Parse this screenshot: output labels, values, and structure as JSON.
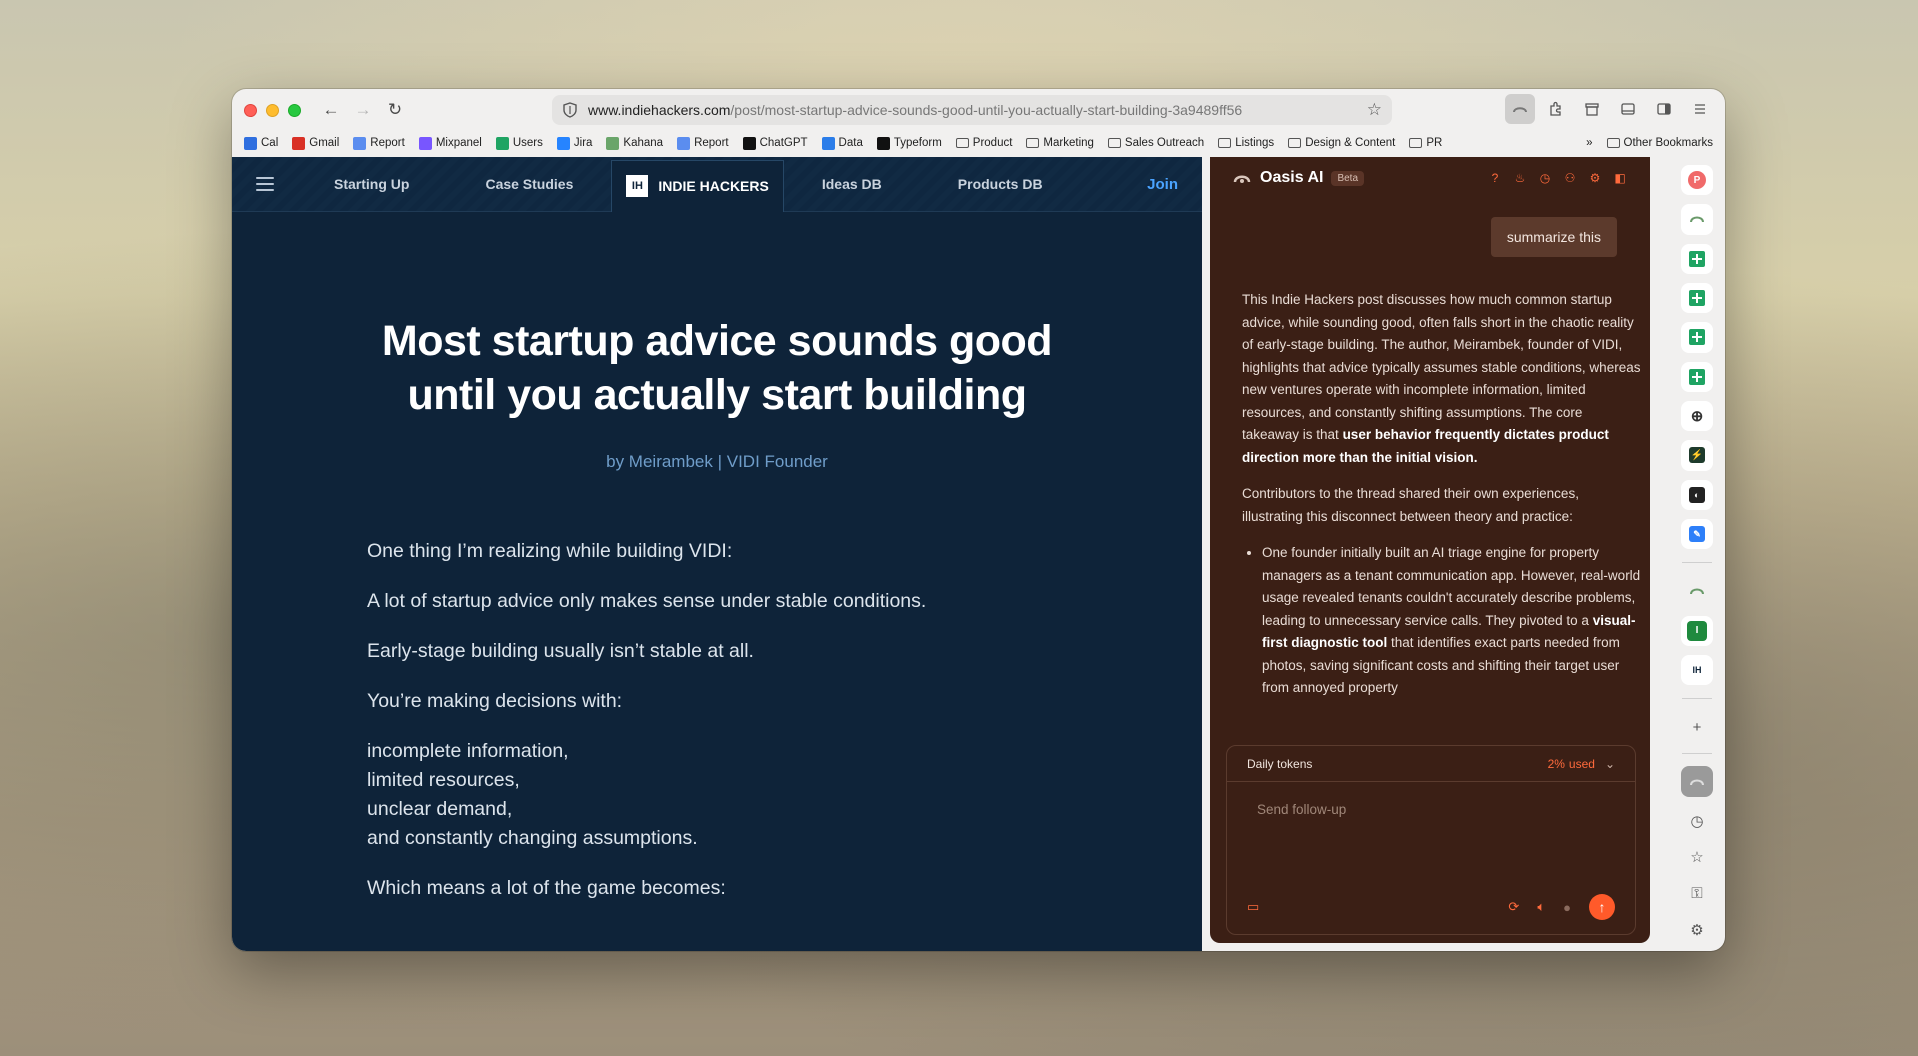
{
  "browser": {
    "url_domain": "www.indiehackers.com",
    "url_path": "/post/most-startup-advice-sounds-good-until-you-actually-start-building-3a9489ff56"
  },
  "bookmarks": [
    {
      "label": "Cal",
      "icon": "calendar-icon",
      "color": "#2f6fdf"
    },
    {
      "label": "Gmail",
      "icon": "gmail-icon",
      "color": "#d93025"
    },
    {
      "label": "Report",
      "icon": "report-icon",
      "color": "#5b8def"
    },
    {
      "label": "Mixpanel",
      "icon": "mixpanel-icon",
      "color": "#7856ff"
    },
    {
      "label": "Users",
      "icon": "sheets-icon",
      "color": "#1fa463"
    },
    {
      "label": "Jira",
      "icon": "jira-icon",
      "color": "#2684ff"
    },
    {
      "label": "Kahana",
      "icon": "kahana-icon",
      "color": "#6aa56a"
    },
    {
      "label": "Report",
      "icon": "report-icon",
      "color": "#5b8def"
    },
    {
      "label": "ChatGPT",
      "icon": "chatgpt-icon",
      "color": "#111111"
    },
    {
      "label": "Data",
      "icon": "data-icon",
      "color": "#2b7de9"
    },
    {
      "label": "Typeform",
      "icon": "typeform-icon",
      "color": "#111111"
    },
    {
      "label": "Product",
      "icon": "folder-icon",
      "color": ""
    },
    {
      "label": "Marketing",
      "icon": "folder-icon",
      "color": ""
    },
    {
      "label": "Sales Outreach",
      "icon": "folder-icon",
      "color": ""
    },
    {
      "label": "Listings",
      "icon": "folder-icon",
      "color": ""
    },
    {
      "label": "Design & Content",
      "icon": "folder-icon",
      "color": ""
    },
    {
      "label": "PR",
      "icon": "folder-icon",
      "color": ""
    }
  ],
  "other_bookmarks": "Other Bookmarks",
  "ih": {
    "nav": [
      "Starting Up",
      "Case Studies",
      "Ideas DB",
      "Products DB"
    ],
    "brand": "INDIE HACKERS",
    "brand_logo": "IH",
    "join": "Join",
    "title": "Most startup advice sounds good until you actually start building",
    "byline": "by Meirambek | VIDI Founder",
    "paragraphs": [
      "One thing I’m realizing while building VIDI:",
      "A lot of startup advice only makes sense under stable conditions.",
      "Early-stage building usually isn’t stable at all.",
      "You’re making decisions with:"
    ],
    "list": [
      "incomplete information,",
      "limited resources,",
      "unclear demand,",
      "and constantly changing assumptions."
    ],
    "last_line": "Which means a lot of the game becomes:"
  },
  "oasis": {
    "name": "Oasis AI",
    "badge": "Beta",
    "user_message": "summarize this",
    "answer_p1_a": "This Indie Hackers post discusses how much common startup advice, while sounding good, often falls short in the chaotic reality of early-stage building. The author, Meirambek, founder of VIDI, highlights that advice typically assumes stable conditions, whereas new ventures operate with incomplete information, limited resources, and constantly shifting assumptions. The core takeaway is that ",
    "answer_p1_bold": "user behavior frequently dictates product direction more than the initial vision.",
    "answer_p2": "Contributors to the thread shared their own experiences, illustrating this disconnect between theory and practice:",
    "bullet_a": "One founder initially built an AI triage engine for property managers as a tenant communication app. However, real-world usage revealed tenants couldn't accurately describe problems, leading to unnecessary service calls. They pivoted to a ",
    "bullet_bold": "visual-first diagnostic tool",
    "bullet_b": " that identifies exact parts needed from photos, saving significant costs and shifting their target user from annoyed property",
    "tokens_label": "Daily tokens",
    "tokens_used_pct": "2%",
    "tokens_used_label": "used",
    "followup_placeholder": "Send follow-up",
    "accent": "#ff6a3c"
  }
}
